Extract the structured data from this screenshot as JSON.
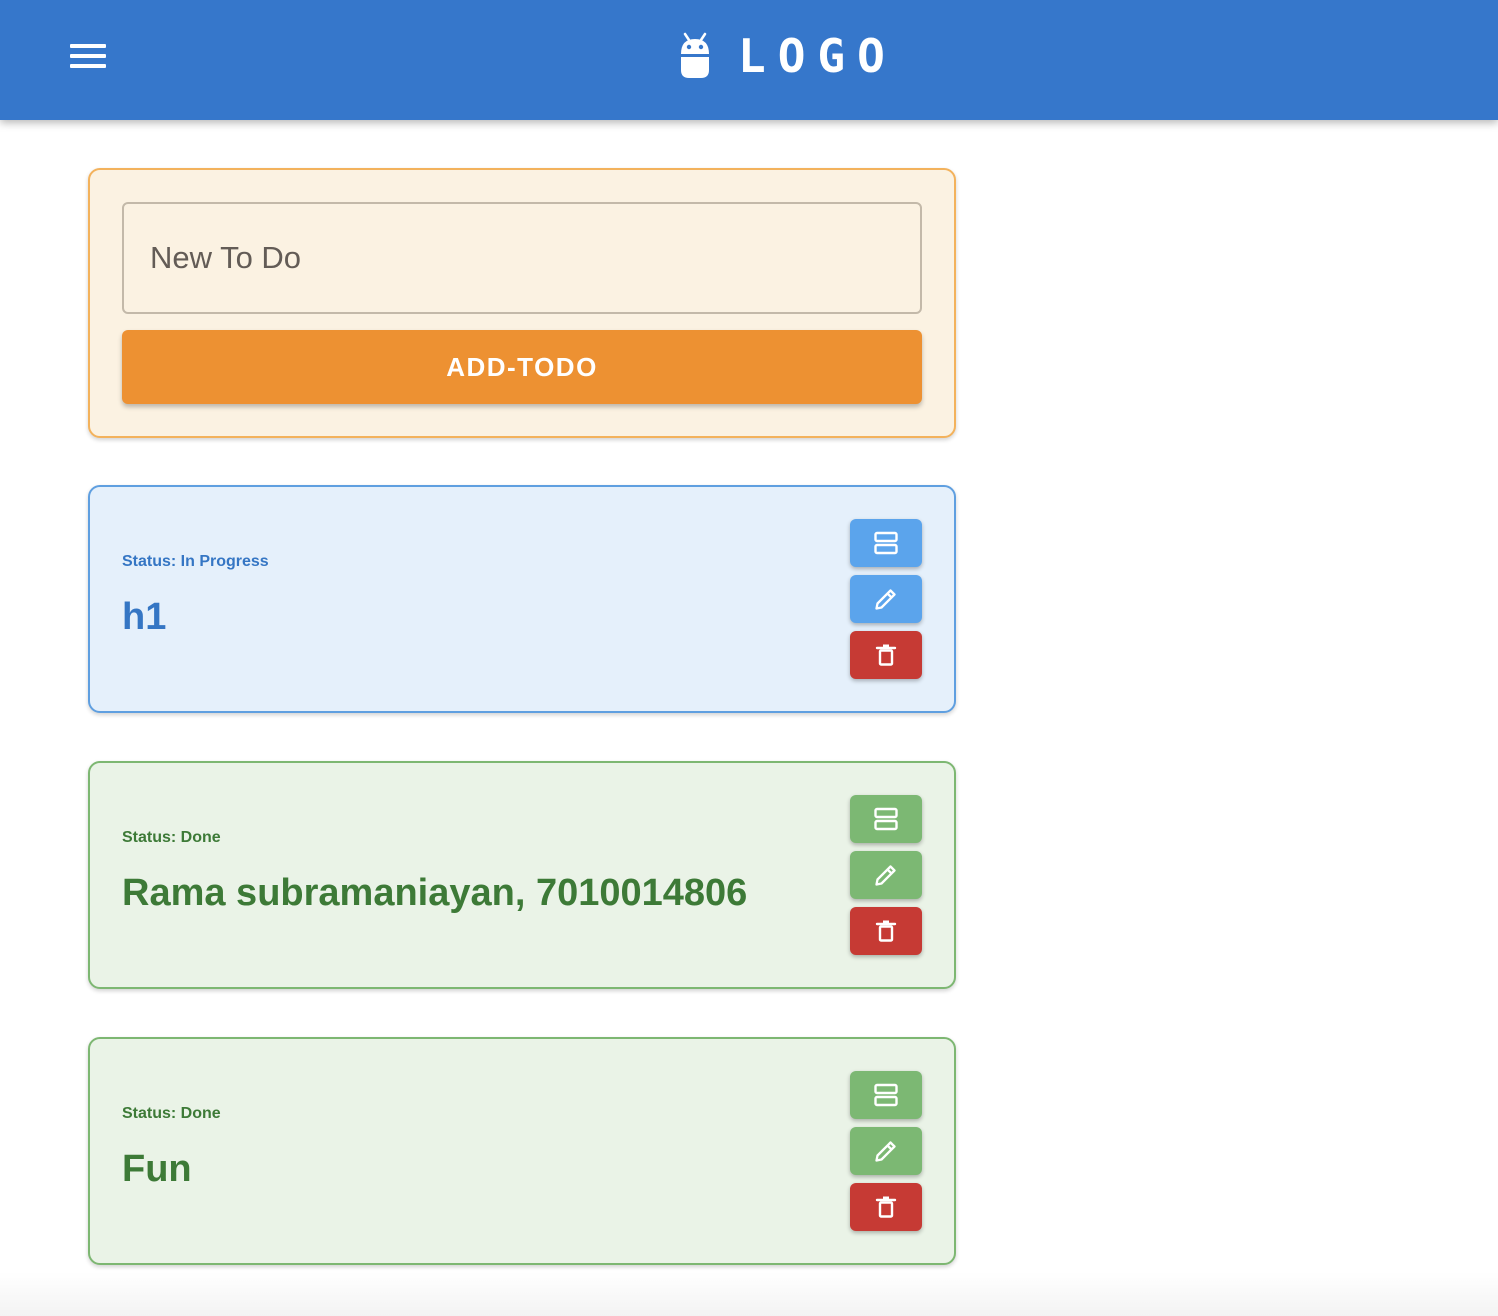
{
  "appbar": {
    "menu_icon": "hamburger-menu-icon",
    "logo_icon": "android-icon",
    "logo_text": "LOGO",
    "color": "#3677cb"
  },
  "new_todo": {
    "placeholder": "New To Do",
    "value": "",
    "add_button_label": "ADD-TODO",
    "button_color": "#ed9132"
  },
  "todos": [
    {
      "status": "Status: In Progress",
      "title": "h1",
      "accent_color": "#5ba4ec",
      "actions": [
        "status-toggle-icon",
        "pencil-icon",
        "trash-icon"
      ]
    },
    {
      "status": "Status: Done",
      "title": "Rama subramaniayan, 7010014806",
      "accent_color": "#7cb873",
      "actions": [
        "status-toggle-icon",
        "pencil-icon",
        "trash-icon"
      ]
    },
    {
      "status": "Status: Done",
      "title": "Fun",
      "accent_color": "#7cb873",
      "actions": [
        "status-toggle-icon",
        "pencil-icon",
        "trash-icon"
      ]
    }
  ],
  "colors": {
    "delete": "#c63a34",
    "in_progress_text": "#3576c4",
    "done_text": "#3d7a37"
  }
}
